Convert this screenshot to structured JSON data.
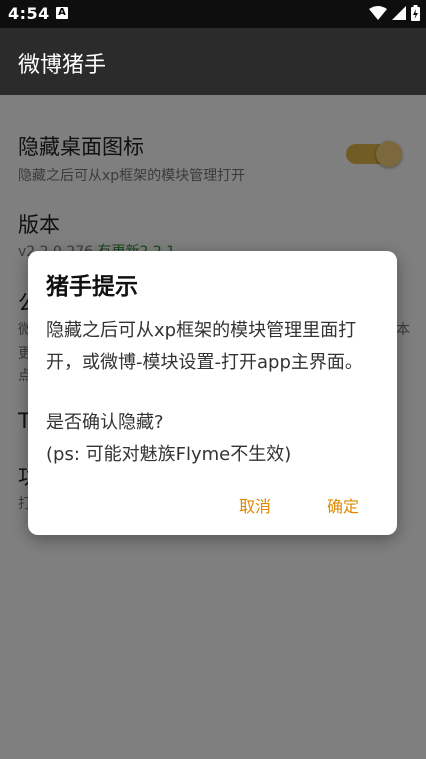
{
  "status_bar": {
    "time": "4:54",
    "notification_glyph": "A",
    "icons": [
      "wifi-icon",
      "cellular-signal-icon",
      "battery-charging-icon"
    ]
  },
  "app_bar": {
    "title": "微博猪手"
  },
  "settings": {
    "hide_icon": {
      "title": "隐藏桌面图标",
      "subtitle": "隐藏之后可从xp框架的模块管理打开",
      "toggle_on": true
    },
    "version": {
      "title": "版本",
      "subtitle": "v2.2.0.276",
      "update_text": "有更新2.2.1"
    },
    "item3": {
      "title_fragment": "公",
      "sub_line1_left": "微",
      "sub_line1_right": "本",
      "sub_line2": "更",
      "sub_line3": "点"
    },
    "item4": {
      "title_fragment": "T"
    },
    "item5": {
      "title_fragment": "功",
      "sub_fragment": "打"
    }
  },
  "dialog": {
    "title": "猪手提示",
    "message_line1": "隐藏之后可从xp框架的模块管理里面打",
    "message_line2": "开，或微博-模块设置-打开app主界面。",
    "question": "是否确认隐藏?",
    "note": "(ps: 可能对魅族Flyme不生效)",
    "cancel_label": "取消",
    "confirm_label": "确定"
  },
  "colors": {
    "accent": "#e08a00",
    "toggle_track": "#e3b94a",
    "toggle_thumb": "#f7d17a",
    "app_bar": "#2b2b2b",
    "status_bar": "#0e0e0e",
    "update_text": "#2e8b2e"
  }
}
